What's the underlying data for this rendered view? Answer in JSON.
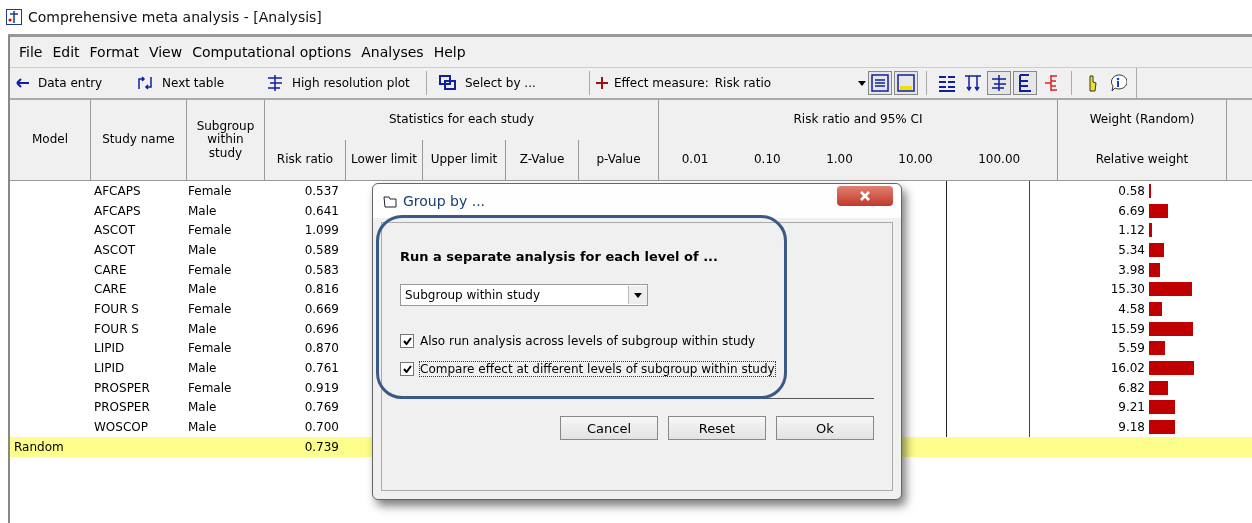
{
  "window": {
    "title": "Comprehensive meta analysis - [Analysis]"
  },
  "menu": [
    "File",
    "Edit",
    "Format",
    "View",
    "Computational options",
    "Analyses",
    "Help"
  ],
  "toolbar": {
    "buttons": [
      {
        "kind": "back",
        "label": "Data entry"
      },
      {
        "kind": "next",
        "label": "Next table"
      },
      {
        "kind": "plot",
        "label": "High resolution plot"
      },
      {
        "kind": "select",
        "label": "Select by ..."
      }
    ],
    "effect": {
      "label": "Effect measure:",
      "value": "Risk ratio"
    },
    "icons": [
      {
        "kind": "list",
        "pressed": true
      },
      {
        "kind": "highlight",
        "pressed": true
      },
      {
        "kind": "columns",
        "pressed": false
      },
      {
        "kind": "arrows",
        "pressed": false
      },
      {
        "kind": "forest",
        "pressed": true
      },
      {
        "kind": "bracket",
        "pressed": true
      },
      {
        "kind": "redbracket",
        "pressed": false
      },
      {
        "kind": "pointer",
        "pressed": false
      },
      {
        "kind": "info",
        "pressed": false
      }
    ]
  },
  "table": {
    "headers": {
      "model": "Model",
      "study": "Study name",
      "subgroup": "Subgroup within study",
      "stats": "Statistics for each study",
      "ci": "Risk ratio and 95% CI",
      "weight": "Weight (Random)"
    },
    "stat_columns": [
      "Risk ratio",
      "Lower limit",
      "Upper limit",
      "Z-Value",
      "p-Value"
    ],
    "ticks": [
      "0.01",
      "0.10",
      "1.00",
      "10.00",
      "100.00"
    ],
    "weight_column": "Relative weight",
    "rows": [
      {
        "study": "AFCAPS",
        "subgroup": "Female",
        "risk_ratio": "0.537",
        "weight": "0.58"
      },
      {
        "study": "AFCAPS",
        "subgroup": "Male",
        "risk_ratio": "0.641",
        "weight": "6.69"
      },
      {
        "study": "ASCOT",
        "subgroup": "Female",
        "risk_ratio": "1.099",
        "weight": "1.12"
      },
      {
        "study": "ASCOT",
        "subgroup": "Male",
        "risk_ratio": "0.589",
        "weight": "5.34"
      },
      {
        "study": "CARE",
        "subgroup": "Female",
        "risk_ratio": "0.583",
        "weight": "3.98"
      },
      {
        "study": "CARE",
        "subgroup": "Male",
        "risk_ratio": "0.816",
        "weight": "15.30"
      },
      {
        "study": "FOUR S",
        "subgroup": "Female",
        "risk_ratio": "0.669",
        "weight": "4.58"
      },
      {
        "study": "FOUR S",
        "subgroup": "Male",
        "risk_ratio": "0.696",
        "weight": "15.59"
      },
      {
        "study": "LIPID",
        "subgroup": "Female",
        "risk_ratio": "0.870",
        "weight": "5.59"
      },
      {
        "study": "LIPID",
        "subgroup": "Male",
        "risk_ratio": "0.761",
        "weight": "16.02"
      },
      {
        "study": "PROSPER",
        "subgroup": "Female",
        "risk_ratio": "0.919",
        "weight": "6.82"
      },
      {
        "study": "PROSPER",
        "subgroup": "Male",
        "risk_ratio": "0.769",
        "weight": "9.21"
      },
      {
        "study": "WOSCOP",
        "subgroup": "Male",
        "risk_ratio": "0.700",
        "weight": "9.18"
      }
    ],
    "summary": {
      "model": "Random",
      "risk_ratio": "0.739"
    }
  },
  "dialog": {
    "title": "Group by ...",
    "heading": "Run a separate analysis for each level of ...",
    "select": "Subgroup within study",
    "checkboxes": [
      {
        "label": "Also run analysis across levels of subgroup within study",
        "checked": true,
        "focused": false
      },
      {
        "label": "Compare effect at different levels of subgroup within study",
        "checked": true,
        "focused": true
      }
    ],
    "buttons": [
      "Cancel",
      "Reset",
      "Ok"
    ]
  }
}
